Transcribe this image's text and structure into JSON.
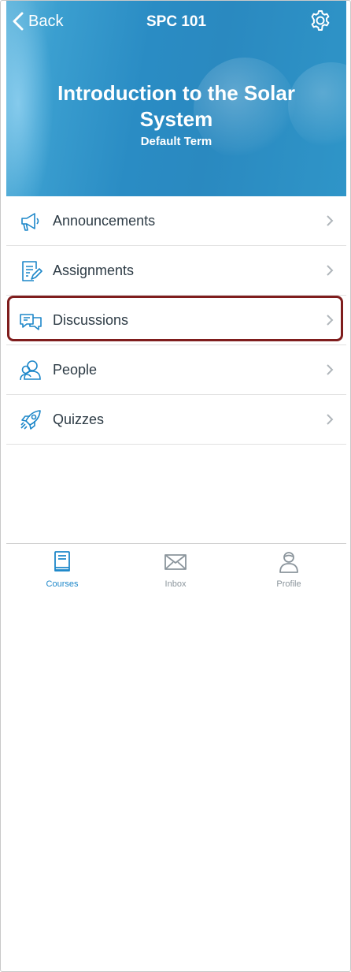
{
  "header": {
    "back_label": "Back",
    "nav_title": "SPC 101",
    "course_title": "Introduction to the Solar System",
    "term": "Default Term"
  },
  "menu": {
    "items": [
      {
        "label": "Announcements",
        "icon": "megaphone-icon"
      },
      {
        "label": "Assignments",
        "icon": "assignment-icon"
      },
      {
        "label": "Discussions",
        "icon": "discussion-icon"
      },
      {
        "label": "People",
        "icon": "people-icon"
      },
      {
        "label": "Quizzes",
        "icon": "rocket-icon"
      }
    ]
  },
  "tabbar": {
    "items": [
      {
        "label": "Courses",
        "icon": "book-icon",
        "selected": true
      },
      {
        "label": "Inbox",
        "icon": "envelope-icon",
        "selected": false
      },
      {
        "label": "Profile",
        "icon": "user-icon",
        "selected": false
      }
    ]
  },
  "colors": {
    "accent": "#1d87c9",
    "text": "#2d3b45",
    "muted": "#8b959c",
    "highlight_border": "#7f1d1d"
  }
}
